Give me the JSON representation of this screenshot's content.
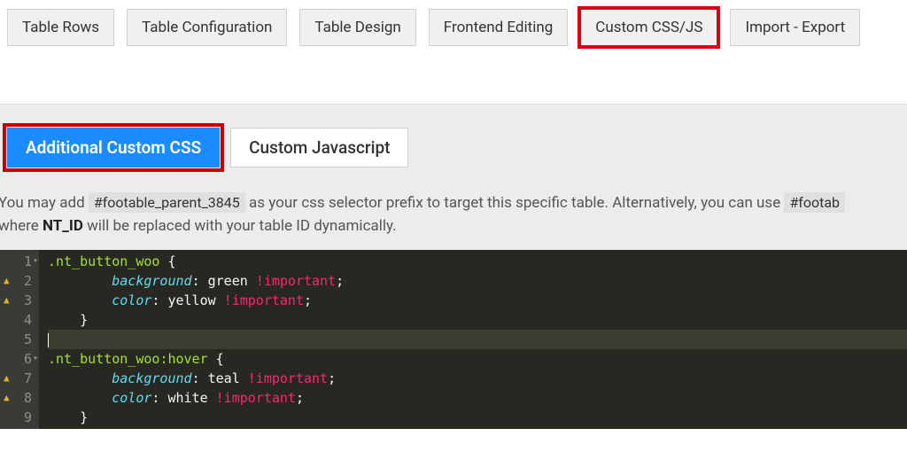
{
  "top_tabs": {
    "rows": "Table Rows",
    "config": "Table Configuration",
    "design": "Table Design",
    "editing": "Frontend Editing",
    "css": "Custom CSS/JS",
    "import": "Import - Export"
  },
  "sub_tabs": {
    "css": "Additional Custom CSS",
    "js": "Custom Javascript"
  },
  "help": {
    "pre": "You may add ",
    "chip1": "#footable_parent_3845",
    "mid": " as your css selector prefix to target this specific table. Alternatively, you can use ",
    "chip2": "#footab",
    "line2_pre": "where ",
    "ntid": "NT_ID",
    "line2_post": " will be replaced with your table ID dynamically."
  },
  "code": {
    "l1": {
      "class": ".nt_button_woo",
      "brace": " {"
    },
    "l2": {
      "indent": "        ",
      "prop": "background",
      "colon": ": ",
      "val": "green ",
      "imp": "!important",
      "end": ";"
    },
    "l3": {
      "indent": "        ",
      "prop": "color",
      "colon": ": ",
      "val": "yellow ",
      "imp": "!important",
      "end": ";"
    },
    "l4": "    }",
    "l5": "",
    "l6": {
      "class": ".nt_button_woo",
      "pseudo": ":hover",
      "brace": " {"
    },
    "l7": {
      "indent": "        ",
      "prop": "background",
      "colon": ": ",
      "val": "teal ",
      "imp": "!important",
      "end": ";"
    },
    "l8": {
      "indent": "        ",
      "prop": "color",
      "colon": ": ",
      "val": "white ",
      "imp": "!important",
      "end": ";"
    },
    "l9": "    }"
  },
  "line_numbers": [
    "1",
    "2",
    "3",
    "4",
    "5",
    "6",
    "7",
    "8",
    "9"
  ]
}
